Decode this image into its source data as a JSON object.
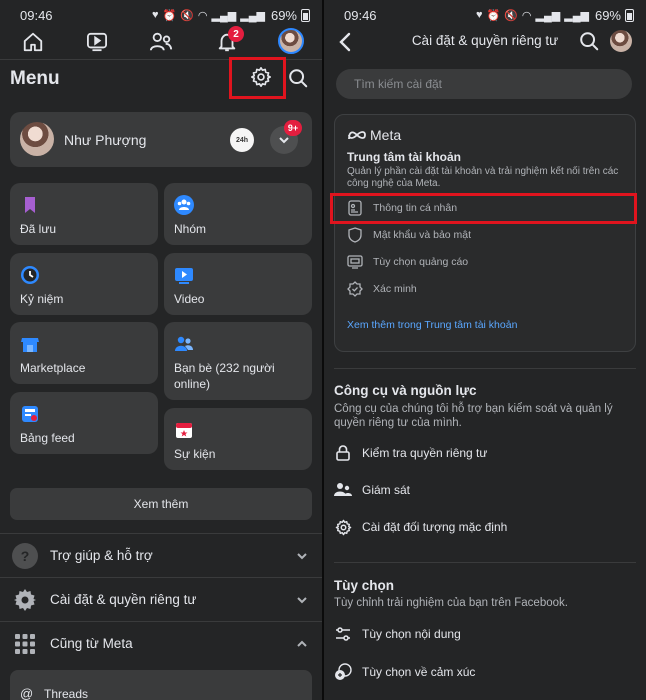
{
  "left": {
    "status": {
      "time": "09:46",
      "battery": "69%"
    },
    "nav": {
      "notification_badge": "2"
    },
    "menu_title": "Menu",
    "profile": {
      "name": "Như Phượng",
      "badge": "9+"
    },
    "tiles": [
      {
        "label": "Đã lưu",
        "icon": "bookmark-icon"
      },
      {
        "label": "Nhóm",
        "icon": "groups-icon"
      },
      {
        "label": "Kỷ niệm",
        "icon": "clock-icon"
      },
      {
        "label": "Video",
        "icon": "video-icon"
      },
      {
        "label": "Marketplace",
        "icon": "marketplace-icon"
      },
      {
        "label": "Bạn bè (232 người online)",
        "icon": "friends-icon"
      },
      {
        "label": "Bảng feed",
        "icon": "feed-icon"
      },
      {
        "label": "Sự kiện",
        "icon": "calendar-icon"
      }
    ],
    "more_button": "Xem thêm",
    "accordions": [
      {
        "label": "Trợ giúp & hỗ trợ",
        "icon": "help-icon"
      },
      {
        "label": "Cài đặt & quyền riêng tư",
        "icon": "gear-icon"
      },
      {
        "label": "Cũng từ Meta",
        "icon": "grid-icon"
      }
    ],
    "threads_label": "Threads"
  },
  "right": {
    "status": {
      "time": "09:46",
      "battery": "69%"
    },
    "header_title": "Cài đặt & quyền riêng tư",
    "search_placeholder": "Tìm kiếm cài đặt",
    "meta": {
      "logo": "Meta",
      "heading": "Trung tâm tài khoản",
      "description": "Quản lý phần cài đặt tài khoản và trải nghiệm kết nối trên các công nghệ của Meta.",
      "items": [
        {
          "label": "Thông tin cá nhân",
          "icon": "id-card-icon"
        },
        {
          "label": "Mật khẩu và bảo mật",
          "icon": "shield-icon"
        },
        {
          "label": "Tùy chọn quảng cáo",
          "icon": "monitor-icon"
        },
        {
          "label": "Xác minh",
          "icon": "verified-icon"
        }
      ],
      "link": "Xem thêm trong Trung tâm tài khoản"
    },
    "tools": {
      "heading": "Công cụ và nguồn lực",
      "description": "Công cụ của chúng tôi hỗ trợ bạn kiểm soát và quản lý quyền riêng tư của mình.",
      "items": [
        {
          "label": "Kiểm tra quyền riêng tư",
          "icon": "lock-icon"
        },
        {
          "label": "Giám sát",
          "icon": "supervision-icon"
        },
        {
          "label": "Cài đặt đối tượng mặc định",
          "icon": "gear-icon"
        }
      ]
    },
    "options": {
      "heading": "Tùy chọn",
      "description": "Tùy chỉnh trải nghiệm của bạn trên Facebook.",
      "items": [
        {
          "label": "Tùy chọn nội dung",
          "icon": "sliders-icon"
        },
        {
          "label": "Tùy chọn về cảm xúc",
          "icon": "reaction-icon"
        }
      ]
    }
  }
}
